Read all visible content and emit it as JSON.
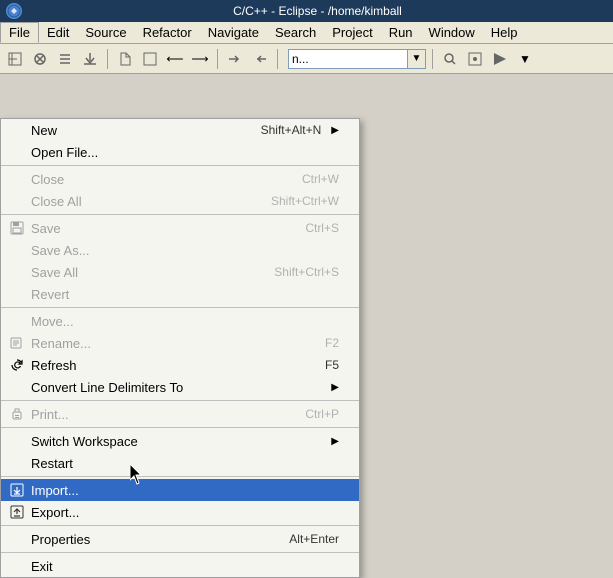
{
  "titleBar": {
    "icon": "●",
    "text": "C/C++ - Eclipse - /home/kimball"
  },
  "menuBar": {
    "items": [
      {
        "label": "File",
        "active": true
      },
      {
        "label": "Edit"
      },
      {
        "label": "Source"
      },
      {
        "label": "Refactor"
      },
      {
        "label": "Navigate"
      },
      {
        "label": "Search"
      },
      {
        "label": "Project"
      },
      {
        "label": "Run"
      },
      {
        "label": "Window"
      },
      {
        "label": "Help"
      }
    ]
  },
  "toolbar": {
    "searchPlaceholder": "n..."
  },
  "fileMenu": {
    "items": [
      {
        "id": "new",
        "label": "New",
        "shortcut": "Shift+Alt+N",
        "hasArrow": true,
        "disabled": false
      },
      {
        "id": "open-file",
        "label": "Open File...",
        "shortcut": "",
        "hasArrow": false,
        "disabled": false
      },
      {
        "id": "sep1",
        "type": "separator"
      },
      {
        "id": "close",
        "label": "Close",
        "shortcut": "Ctrl+W",
        "hasArrow": false,
        "disabled": true
      },
      {
        "id": "close-all",
        "label": "Close All",
        "shortcut": "Shift+Ctrl+W",
        "hasArrow": false,
        "disabled": true
      },
      {
        "id": "sep2",
        "type": "separator"
      },
      {
        "id": "save",
        "label": "Save",
        "shortcut": "Ctrl+S",
        "hasArrow": false,
        "disabled": true,
        "hasIcon": true
      },
      {
        "id": "save-as",
        "label": "Save As...",
        "shortcut": "",
        "hasArrow": false,
        "disabled": true
      },
      {
        "id": "save-all",
        "label": "Save All",
        "shortcut": "Shift+Ctrl+S",
        "hasArrow": false,
        "disabled": true
      },
      {
        "id": "revert",
        "label": "Revert",
        "shortcut": "",
        "hasArrow": false,
        "disabled": true
      },
      {
        "id": "sep3",
        "type": "separator"
      },
      {
        "id": "move",
        "label": "Move...",
        "shortcut": "",
        "hasArrow": false,
        "disabled": true
      },
      {
        "id": "rename",
        "label": "Rename...",
        "shortcut": "F2",
        "hasArrow": false,
        "disabled": true,
        "hasIcon": true
      },
      {
        "id": "refresh",
        "label": "Refresh",
        "shortcut": "F5",
        "hasArrow": false,
        "disabled": false,
        "hasIcon": true
      },
      {
        "id": "convert",
        "label": "Convert Line Delimiters To",
        "shortcut": "",
        "hasArrow": true,
        "disabled": false
      },
      {
        "id": "sep4",
        "type": "separator"
      },
      {
        "id": "print",
        "label": "Print...",
        "shortcut": "Ctrl+P",
        "hasArrow": false,
        "disabled": true,
        "hasIcon": true
      },
      {
        "id": "sep5",
        "type": "separator"
      },
      {
        "id": "switch-workspace",
        "label": "Switch Workspace",
        "shortcut": "",
        "hasArrow": true,
        "disabled": false
      },
      {
        "id": "restart",
        "label": "Restart",
        "shortcut": "",
        "hasArrow": false,
        "disabled": false
      },
      {
        "id": "sep6",
        "type": "separator"
      },
      {
        "id": "import",
        "label": "Import...",
        "shortcut": "",
        "hasArrow": false,
        "disabled": false,
        "highlighted": true,
        "hasIcon": true
      },
      {
        "id": "export",
        "label": "Export...",
        "shortcut": "",
        "hasArrow": false,
        "disabled": false,
        "hasIcon": true
      },
      {
        "id": "sep7",
        "type": "separator"
      },
      {
        "id": "properties",
        "label": "Properties",
        "shortcut": "Alt+Enter",
        "hasArrow": false,
        "disabled": false
      },
      {
        "id": "sep8",
        "type": "separator"
      },
      {
        "id": "exit",
        "label": "Exit",
        "shortcut": "",
        "hasArrow": false,
        "disabled": false
      }
    ]
  },
  "colors": {
    "menuBarBg": "#ece9d8",
    "dropdownBg": "#f5f5f0",
    "highlighted": "#316ac5",
    "titleBarBg": "#1e3a5a",
    "disabledText": "#a0a0a0"
  }
}
